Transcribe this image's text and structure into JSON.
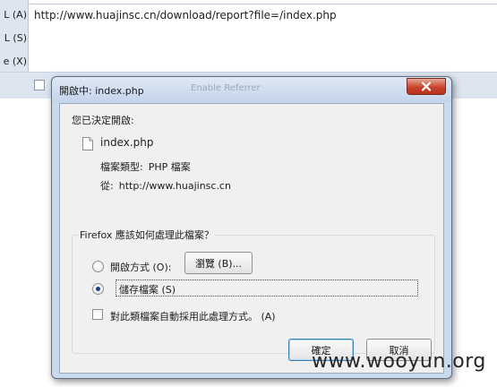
{
  "background": {
    "left_labels": [
      "L (A)",
      "L (S)",
      "e (X)"
    ],
    "url_text": "http://www.huajinsc.cn/download/report?file=/index.php"
  },
  "dialog": {
    "title": "開啟中: index.php",
    "title_ghost": "Enable Referrer",
    "decided_label": "您已決定開啟:",
    "file_icon": "document-icon",
    "file_name": "index.php",
    "type_label": "檔案類型:",
    "type_value": "PHP 檔案",
    "from_label": "從:",
    "from_value": "http://www.huajinsc.cn",
    "group_label": "Firefox 應該如何處理此檔案？",
    "open_with_label": "開啟方式 (O):",
    "browse_button": "瀏覽 (B)...",
    "save_file_label": "儲存檔案 (S)",
    "auto_label": "對此類檔案自動採用此處理方式。 (A)",
    "ok_button": "確定",
    "cancel_button": "取消",
    "selected_option": "save_file",
    "close_icon": "close-icon"
  },
  "watermark": "www.wooyun.org"
}
